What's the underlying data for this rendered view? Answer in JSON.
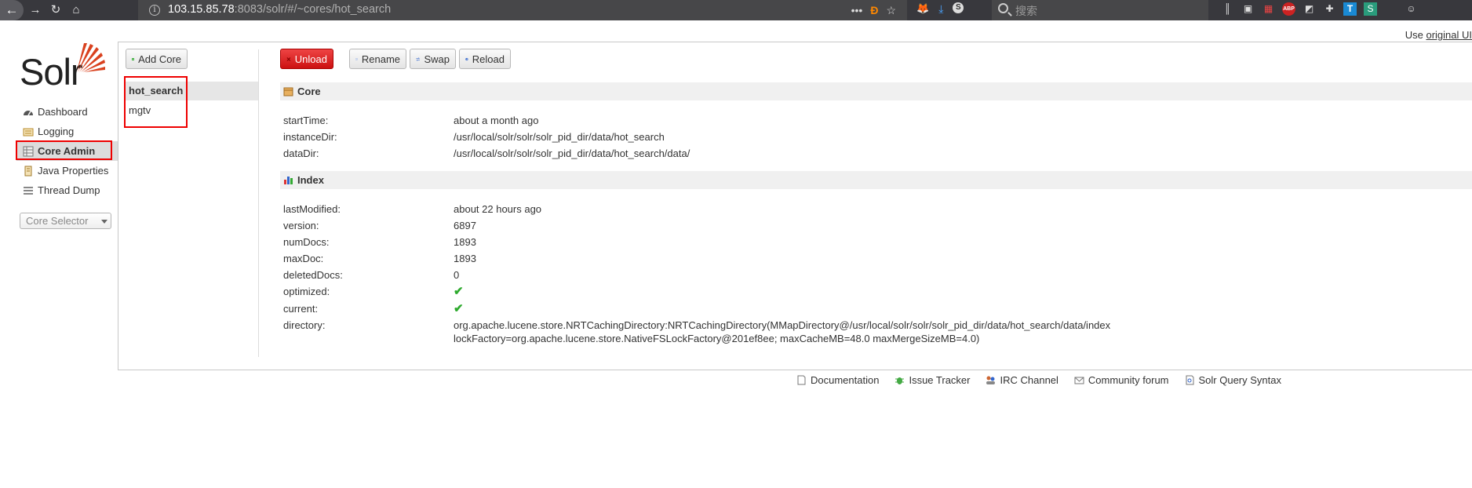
{
  "browser": {
    "url_host": "103.15.85.78",
    "url_rest": ":8083/solr/#/~cores/hot_search",
    "search_placeholder": "搜索",
    "info_glyph": "i",
    "dots": "•••",
    "extension_labels": {
      "abp": "ABP",
      "t": "T",
      "s": "S"
    }
  },
  "top_bar": {
    "use_text": "Use ",
    "original_ui_link": "original UI"
  },
  "logo": {
    "text": "Solr"
  },
  "nav": {
    "items": [
      {
        "label": "Dashboard",
        "icon": "dashboard-icon"
      },
      {
        "label": "Logging",
        "icon": "logging-icon"
      },
      {
        "label": "Core Admin",
        "icon": "core-admin-icon",
        "active": true
      },
      {
        "label": "Java Properties",
        "icon": "java-properties-icon"
      },
      {
        "label": "Thread Dump",
        "icon": "thread-dump-icon"
      }
    ],
    "core_selector": "Core Selector"
  },
  "actions": {
    "add_core": "Add Core",
    "unload": "Unload",
    "rename": "Rename",
    "swap": "Swap",
    "reload": "Reload"
  },
  "cores": [
    "hot_search",
    "mgtv"
  ],
  "selected_core": "hot_search",
  "core_section": {
    "title": "Core",
    "rows": [
      {
        "key": "startTime:",
        "value": "about a month ago"
      },
      {
        "key": "instanceDir:",
        "value": "/usr/local/solr/solr/solr_pid_dir/data/hot_search"
      },
      {
        "key": "dataDir:",
        "value": "/usr/local/solr/solr/solr_pid_dir/data/hot_search/data/"
      }
    ]
  },
  "index_section": {
    "title": "Index",
    "rows": [
      {
        "key": "lastModified:",
        "value": "about 22 hours ago"
      },
      {
        "key": "version:",
        "value": "6897"
      },
      {
        "key": "numDocs:",
        "value": "1893"
      },
      {
        "key": "maxDoc:",
        "value": "1893"
      },
      {
        "key": "deletedDocs:",
        "value": "0"
      },
      {
        "key": "optimized:",
        "value": "✔"
      },
      {
        "key": "current:",
        "value": "✔"
      },
      {
        "key": "directory:",
        "value": "org.apache.lucene.store.NRTCachingDirectory:NRTCachingDirectory(MMapDirectory@/usr/local/solr/solr/solr_pid_dir/data/hot_search/data/index"
      }
    ],
    "directory_line2": "lockFactory=org.apache.lucene.store.NativeFSLockFactory@201ef8ee; maxCacheMB=48.0 maxMergeSizeMB=4.0)"
  },
  "footer": {
    "links": [
      "Documentation",
      "Issue Tracker",
      "IRC Channel",
      "Community forum",
      "Solr Query Syntax"
    ]
  },
  "colors": {
    "accent_red": "#e00000",
    "unload_red": "#d22222",
    "check_green": "#2eaa2e"
  }
}
